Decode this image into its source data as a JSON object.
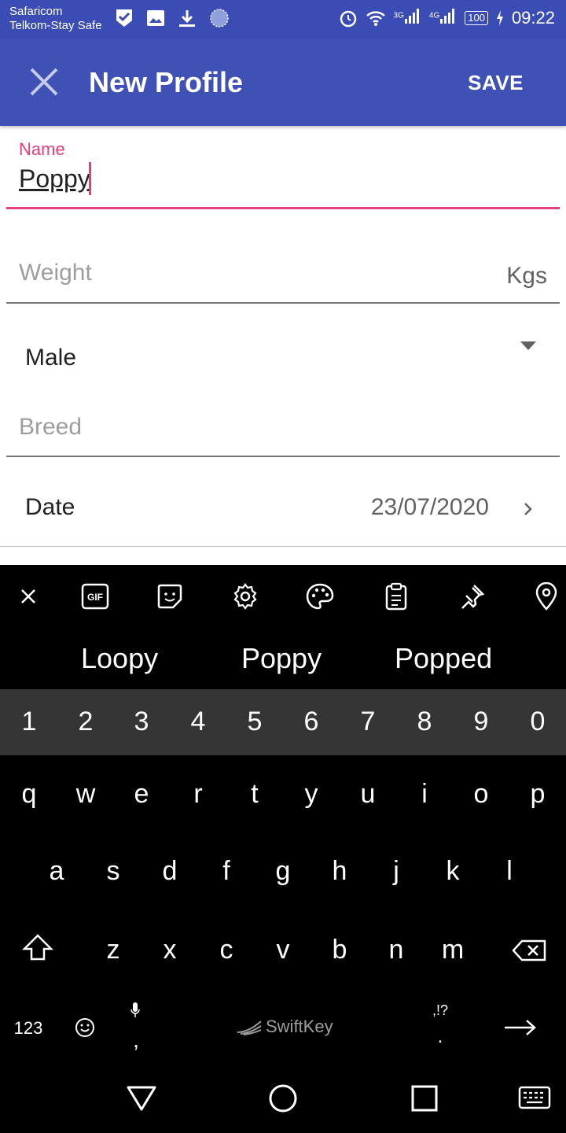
{
  "status_bar": {
    "carrier_1": "Safaricom",
    "carrier_2": "Telkom-Stay Safe",
    "net_1": "3G",
    "net_2": "4G",
    "battery": "100",
    "time": "09:22"
  },
  "app_bar": {
    "title": "New Profile",
    "save_label": "SAVE",
    "color": "#3f51b5"
  },
  "form": {
    "name": {
      "label": "Name",
      "value": "Poppy",
      "accent": "#e53e7e"
    },
    "weight": {
      "placeholder": "Weight",
      "unit": "Kgs"
    },
    "gender": {
      "value": "Male"
    },
    "breed": {
      "placeholder": "Breed"
    },
    "date": {
      "label": "Date",
      "value": "23/07/2020"
    }
  },
  "keyboard": {
    "toolbar_icons": [
      "close-icon",
      "gif-icon",
      "sticker-icon",
      "settings-icon",
      "palette-icon",
      "clipboard-icon",
      "pin-icon",
      "location-icon"
    ],
    "toolbar_gif": "GIF",
    "suggestions": [
      "Loopy",
      "Poppy",
      "Popped"
    ],
    "number_row": [
      "1",
      "2",
      "3",
      "4",
      "5",
      "6",
      "7",
      "8",
      "9",
      "0"
    ],
    "row_1": [
      "q",
      "w",
      "e",
      "r",
      "t",
      "y",
      "u",
      "i",
      "o",
      "p"
    ],
    "row_2": [
      "a",
      "s",
      "d",
      "f",
      "g",
      "h",
      "j",
      "k",
      "l"
    ],
    "row_3": [
      "z",
      "x",
      "c",
      "v",
      "b",
      "n",
      "m"
    ],
    "symbols_label": "123",
    "comma_label": ",",
    "punct_top": ",!?",
    "punct_bottom": ".",
    "brand": "SwiftKey"
  }
}
